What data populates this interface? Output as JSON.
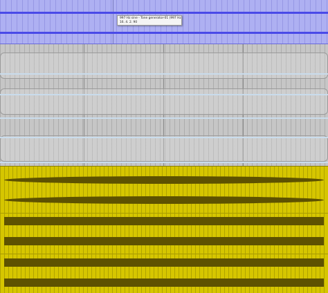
{
  "tracks": [
    {
      "name": "purple-clip-lane",
      "clip_color": "#aeb0f2",
      "waveform_color": "#4a4ae8",
      "selected": true,
      "tooltip": {
        "line1": "997 Hz sine - Tone generator-01 (997 Hz sine)",
        "line2": "16. 4. 2. 90"
      }
    },
    {
      "name": "grey-clip-lane",
      "clip_color": "#c6c6c6",
      "waveform_color": "#c9dcec",
      "muted": true
    },
    {
      "name": "yellow-clip-lane",
      "clip_color": "#d6c600",
      "waveform_color": "#5e5200"
    }
  ]
}
